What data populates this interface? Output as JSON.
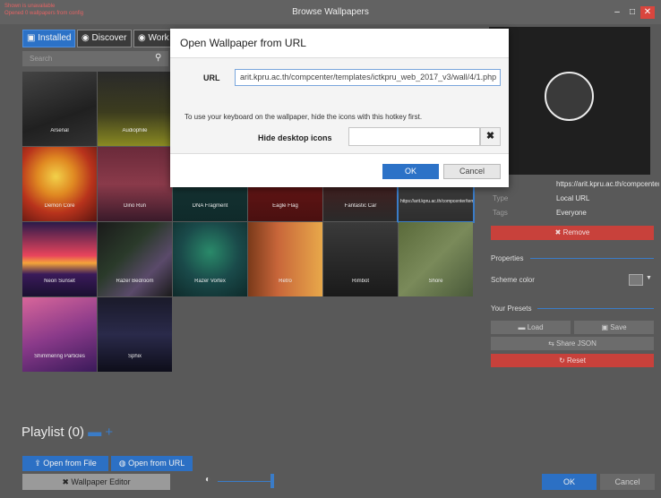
{
  "window": {
    "title": "Browse Wallpapers",
    "warning_line1": "Shown is unavailable",
    "warning_line2": "Opened 0 wallpapers from config",
    "minimize_label": "–",
    "maximize_label": "□",
    "close_label": "✕"
  },
  "tabs": [
    {
      "label": "Installed",
      "icon": "folder-icon"
    },
    {
      "label": "Discover",
      "icon": "compass-icon"
    },
    {
      "label": "Work",
      "icon": "steam-icon"
    }
  ],
  "search": {
    "placeholder": "Search",
    "icon": "search-icon"
  },
  "wallpapers": [
    {
      "label": "Arsenal"
    },
    {
      "label": "Audiophile"
    },
    {
      "label": "Demon Core"
    },
    {
      "label": "Dino Run"
    },
    {
      "label": "DNA Fragment"
    },
    {
      "label": "Eagle Flag"
    },
    {
      "label": "Fantastic Car"
    },
    {
      "label": "https://arit.kpru.ac.th/compcenter/templates/ictkpru..."
    },
    {
      "label": "Neon Sunset"
    },
    {
      "label": "Razer Bedroom"
    },
    {
      "label": "Razer Vortex"
    },
    {
      "label": "Retro"
    },
    {
      "label": "Rimbot"
    },
    {
      "label": "Shore"
    },
    {
      "label": "Shimmering Particles"
    },
    {
      "label": "Sphix"
    }
  ],
  "details": {
    "url_text": "https://arit.kpru.ac.th/compcenter",
    "type_key": "Type",
    "type_value": "Local URL",
    "tags_key": "Tags",
    "tags_value": "Everyone",
    "remove_label": "✖ Remove"
  },
  "properties": {
    "heading": "Properties",
    "scheme_color_label": "Scheme color",
    "scheme_color_value": "#7a7a7a"
  },
  "presets": {
    "heading": "Your Presets",
    "load_label": "Load",
    "save_label": "Save",
    "share_label": "Share JSON",
    "reset_label": "Reset"
  },
  "playlist": {
    "label": "Playlist (0)",
    "folder_icon": "folder-icon",
    "add_icon": "plus-icon"
  },
  "bottom": {
    "open_file_label": "Open from File",
    "open_url_label": "Open from URL",
    "editor_label": "Wallpaper Editor",
    "ok_label": "OK",
    "cancel_label": "Cancel"
  },
  "dialog": {
    "title": "Open Wallpaper from URL",
    "url_label": "URL",
    "url_value": "arit.kpru.ac.th/compcenter/templates/ictkpru_web_2017_v3/wall/4/1.php",
    "hint": "To use your keyboard on the wallpaper, hide the icons with this hotkey first.",
    "hide_label": "Hide desktop icons",
    "hotkey_value": "",
    "clear_label": "✖",
    "ok_label": "OK",
    "cancel_label": "Cancel"
  },
  "colors": {
    "accent": "#2c72c7",
    "danger": "#c8413b",
    "background": "#595959"
  }
}
